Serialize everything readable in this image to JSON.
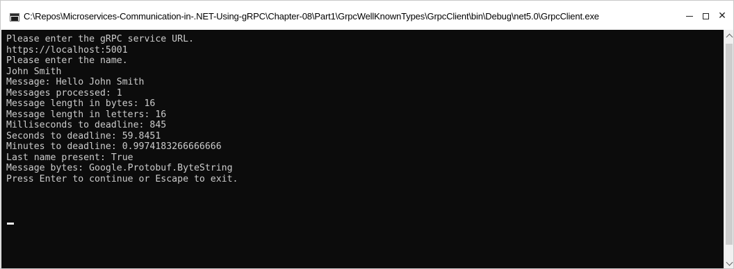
{
  "window": {
    "title": "C:\\Repos\\Microservices-Communication-in-.NET-Using-gRPC\\Chapter-08\\Part1\\GrpcWellKnownTypes\\GrpcClient\\bin\\Debug\\net5.0\\GrpcClient.exe",
    "controls": {
      "minimize_icon": "minimize-icon",
      "maximize_icon": "maximize-icon",
      "close_glyph": "✕"
    }
  },
  "console": {
    "background": "#0c0c0c",
    "foreground": "#cccccc",
    "lines": [
      "Please enter the gRPC service URL.",
      "https://localhost:5001",
      "Please enter the name.",
      "John Smith",
      "Message: Hello John Smith",
      "Messages processed: 1",
      "Message length in bytes: 16",
      "Message length in letters: 16",
      "Milliseconds to deadline: 845",
      "Seconds to deadline: 59.8451",
      "Minutes to deadline: 0.9974183266666666",
      "Last name present: True",
      "Message bytes: Google.Protobuf.ByteString",
      "Press Enter to continue or Escape to exit."
    ]
  },
  "scrollbar": {
    "up_icon": "chevron-up-icon",
    "down_icon": "chevron-down-icon"
  }
}
